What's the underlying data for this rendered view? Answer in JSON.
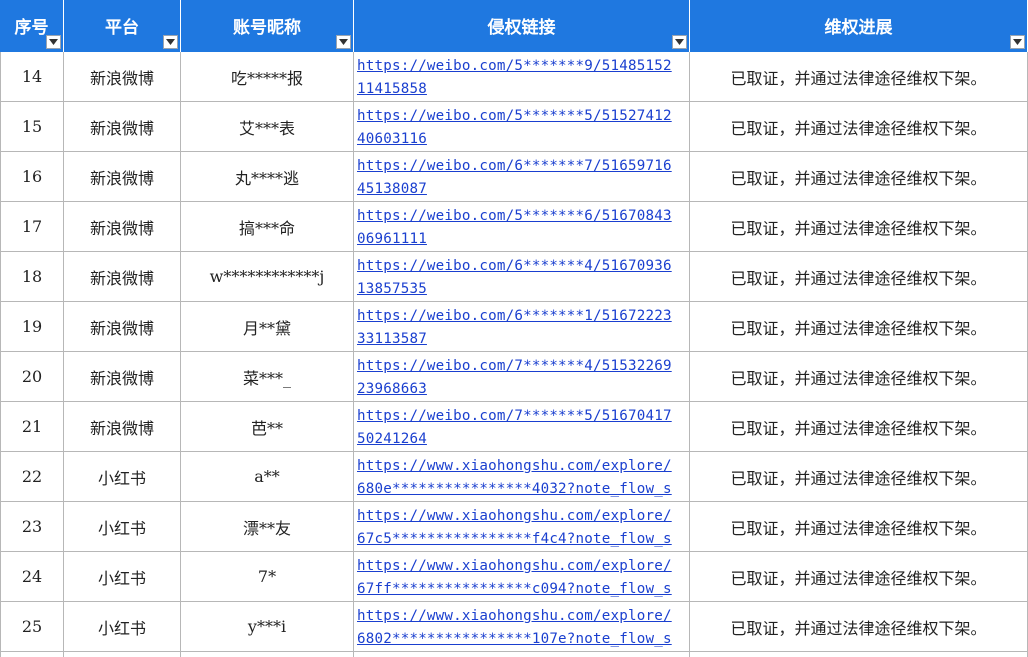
{
  "headers": [
    "序号",
    "平台",
    "账号昵称",
    "侵权链接",
    "维权进展"
  ],
  "rows": [
    {
      "no": "14",
      "platform": "新浪微博",
      "account": "吃*****报",
      "link1": "https://weibo.com/5*******9/51485152",
      "link2": "11415858",
      "status": "已取证，并通过法律途径维权下架。"
    },
    {
      "no": "15",
      "platform": "新浪微博",
      "account": "艾***表",
      "link1": "https://weibo.com/5*******5/51527412",
      "link2": "40603116",
      "status": "已取证，并通过法律途径维权下架。"
    },
    {
      "no": "16",
      "platform": "新浪微博",
      "account": "丸****逃",
      "link1": "https://weibo.com/6*******7/51659716",
      "link2": "45138087",
      "status": "已取证，并通过法律途径维权下架。"
    },
    {
      "no": "17",
      "platform": "新浪微博",
      "account": "搞***命",
      "link1": "https://weibo.com/5*******6/51670843",
      "link2": "06961111",
      "status": "已取证，并通过法律途径维权下架。"
    },
    {
      "no": "18",
      "platform": "新浪微博",
      "account": "w************j",
      "link1": "https://weibo.com/6*******4/51670936",
      "link2": "13857535",
      "status": "已取证，并通过法律途径维权下架。"
    },
    {
      "no": "19",
      "platform": "新浪微博",
      "account": "月**黛",
      "link1": "https://weibo.com/6*******1/51672223",
      "link2": "33113587",
      "status": "已取证，并通过法律途径维权下架。"
    },
    {
      "no": "20",
      "platform": "新浪微博",
      "account": "菜***_",
      "link1": "https://weibo.com/7*******4/51532269",
      "link2": "23968663",
      "status": "已取证，并通过法律途径维权下架。"
    },
    {
      "no": "21",
      "platform": "新浪微博",
      "account": "芭**",
      "link1": "https://weibo.com/7*******5/51670417",
      "link2": "50241264",
      "status": "已取证，并通过法律途径维权下架。"
    },
    {
      "no": "22",
      "platform": "小红书",
      "account": "a**",
      "link1": "https://www.xiaohongshu.com/explore/",
      "link2": "680e****************4032?note_flow_s",
      "status": "已取证，并通过法律途径维权下架。"
    },
    {
      "no": "23",
      "platform": "小红书",
      "account": "漂**友",
      "link1": "https://www.xiaohongshu.com/explore/",
      "link2": "67c5****************f4c4?note_flow_s",
      "status": "已取证，并通过法律途径维权下架。"
    },
    {
      "no": "24",
      "platform": "小红书",
      "account": "7*",
      "link1": "https://www.xiaohongshu.com/explore/",
      "link2": "67ff****************c094?note_flow_s",
      "status": "已取证，并通过法律途径维权下架。"
    },
    {
      "no": "25",
      "platform": "小红书",
      "account": "y***i",
      "link1": "https://www.xiaohongshu.com/explore/",
      "link2": "6802****************107e?note_flow_s",
      "status": "已取证，并通过法律途径维权下架。"
    }
  ],
  "icons": {
    "filter": "filter-dropdown-icon"
  },
  "colors": {
    "header_bg": "#1f78e0",
    "header_text": "#ffffff",
    "link": "#1a3fcf",
    "grid": "#b7b7b7"
  }
}
